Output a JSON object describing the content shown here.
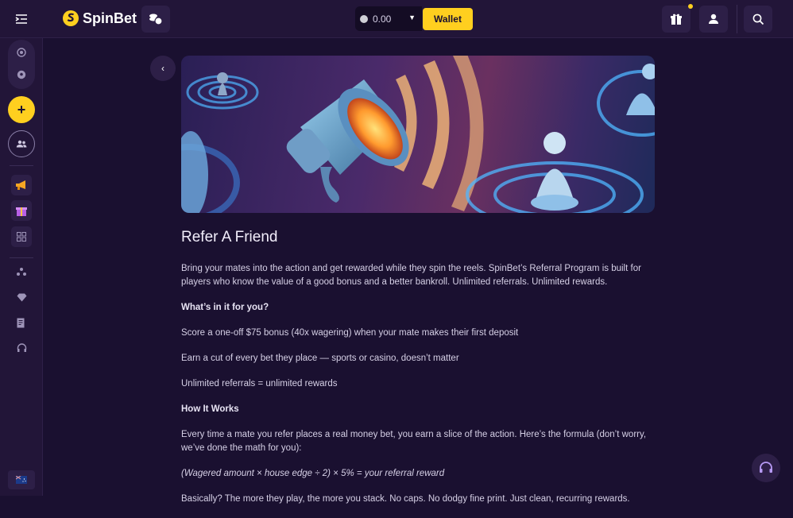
{
  "header": {
    "brand": "SpinBet",
    "balance": "0.00",
    "wallet_label": "Wallet"
  },
  "article": {
    "title": "Refer A Friend",
    "intro": "Bring your mates into the action and get rewarded while they spin the reels. SpinBet’s Referral Program is built for players who know the value of a good bonus and a better bankroll. Unlimited referrals. Unlimited rewards.",
    "section1_heading": "What’s in it for you?",
    "benefit1": "Score a one-off $75 bonus (40x wagering) when your mate makes their first deposit",
    "benefit2": "Earn a cut of every bet they place — sports or casino, doesn’t matter",
    "benefit3": "Unlimited referrals = unlimited rewards",
    "section2_heading": "How It Works",
    "how_it_works": "Every time a mate you refer places a real money bet, you earn a slice of the action. Here’s the formula (don’t worry, we’ve done the math for you):",
    "formula": "(Wagered amount × house edge ÷ 2) × 5% = your referral reward",
    "closing": "Basically? The more they play, the more you stack. No caps. No dodgy fine print. Just clean, recurring rewards."
  },
  "icons": {
    "menu": "menu-collapse-icon",
    "coins": "coins-icon",
    "gift": "gift-icon",
    "user": "user-icon",
    "search": "search-icon",
    "back": "chevron-left-icon",
    "support": "headset-icon"
  },
  "colors": {
    "accent": "#ffcf1f",
    "background": "#1a1030",
    "panel": "#221538"
  }
}
